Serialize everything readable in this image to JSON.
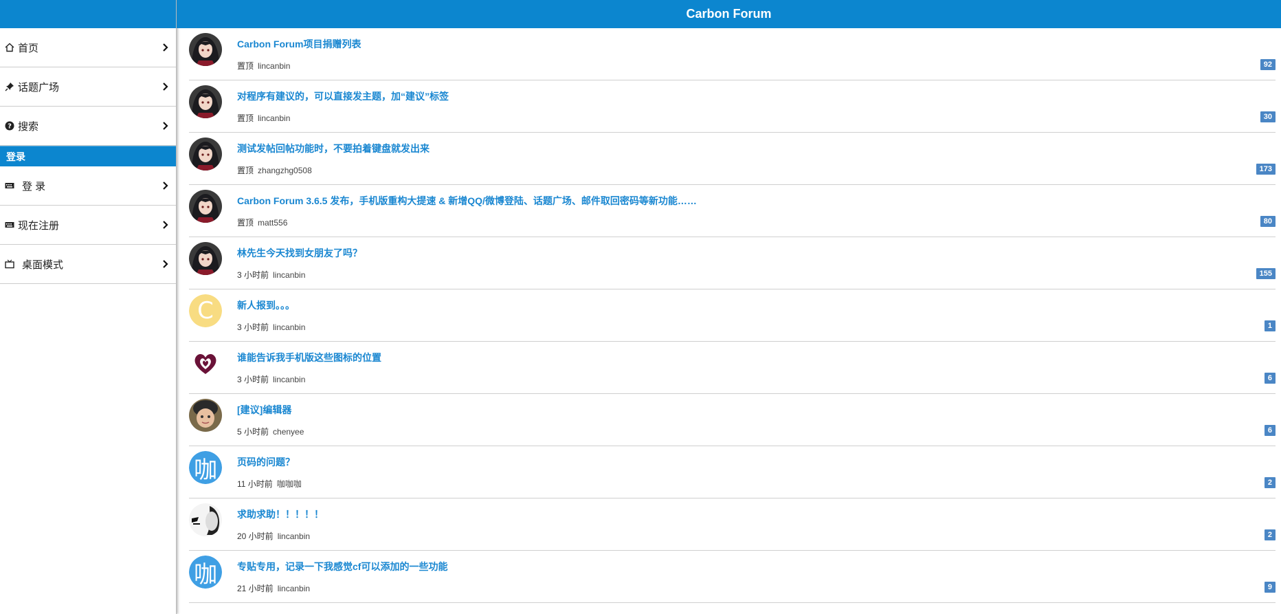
{
  "header": {
    "title": "Carbon Forum"
  },
  "sidebar": {
    "items": [
      {
        "label": "首页",
        "icon": "home-icon"
      },
      {
        "label": "话题广场",
        "icon": "pin-icon"
      },
      {
        "label": "搜索",
        "icon": "question-circle-icon"
      }
    ],
    "section_label": "登录",
    "account_items": [
      {
        "label": "登 录",
        "icon": "keyboard-icon"
      },
      {
        "label": "现在注册",
        "icon": "keyboard-icon"
      },
      {
        "label": "桌面模式",
        "icon": "tv-icon"
      }
    ]
  },
  "topics": [
    {
      "title": "Carbon Forum项目捐赠列表",
      "time": "置顶",
      "author": "lincanbin",
      "count": "92",
      "avatar": "anime-girl"
    },
    {
      "title": "对程序有建议的，可以直接发主题，加“建议”标签",
      "time": "置顶",
      "author": "lincanbin",
      "count": "30",
      "avatar": "anime-girl"
    },
    {
      "title": "测试发帖回帖功能时，不要拍着键盘就发出来",
      "time": "置顶",
      "author": "zhangzhg0508",
      "count": "173",
      "avatar": "anime-girl"
    },
    {
      "title": "Carbon Forum 3.6.5 发布，手机版重构大提速 & 新增QQ/微博登陆、话题广场、邮件取回密码等新功能……",
      "time": "置顶",
      "author": "matt556",
      "count": "80",
      "avatar": "anime-girl"
    },
    {
      "title": "林先生今天找到女朋友了吗？",
      "time": "3 小时前",
      "author": "lincanbin",
      "count": "155",
      "avatar": "anime-girl"
    },
    {
      "title": "新人报到。。。",
      "time": "3 小时前",
      "author": "lincanbin",
      "count": "1",
      "avatar": "letter",
      "letter": "C",
      "color": "#f8dc82"
    },
    {
      "title": "谁能告诉我手机版这些图标的位置",
      "time": "3 小时前",
      "author": "lincanbin",
      "count": "6",
      "avatar": "heart"
    },
    {
      "title": "[建议]编辑器",
      "time": "5 小时前",
      "author": "chenyee",
      "count": "6",
      "avatar": "child"
    },
    {
      "title": "页码的问题？",
      "time": "11 小时前",
      "author": "咖咖咖",
      "count": "2",
      "avatar": "letter",
      "letter": "咖",
      "color": "#3f9fe4"
    },
    {
      "title": "求助求助！！！！！",
      "time": "20 小时前",
      "author": "lincanbin",
      "count": "2",
      "avatar": "sketch"
    },
    {
      "title": "专贴专用，记录一下我感觉cf可以添加的一些功能",
      "time": "21 小时前",
      "author": "lincanbin",
      "count": "9",
      "avatar": "letter",
      "letter": "咖",
      "color": "#3f9fe4"
    }
  ],
  "colors": {
    "brand": "#0c86cf",
    "link": "#1a87d1",
    "badge": "#4a86c5"
  }
}
